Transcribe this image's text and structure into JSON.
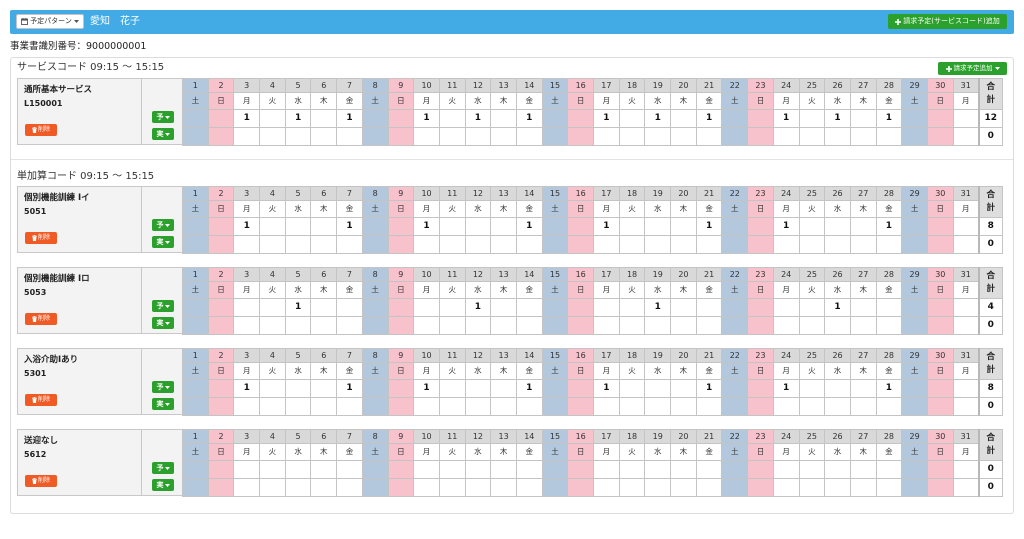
{
  "colors": {
    "header_bar": "#42aae4",
    "button_green": "#2ca02c",
    "button_red": "#f05a24",
    "saturday": "#b3c7dd",
    "sunday": "#f8c2cd",
    "day_header": "#d9d9d9"
  },
  "icons": {
    "pattern": "calendar-icon",
    "add": "plus-icon",
    "menu": "chevron-down-icon",
    "delete": "trash-icon"
  },
  "header": {
    "pattern_button": "予定パターン",
    "user_name": "愛知　花子",
    "add_service_code_button": "請求予定(サービスコード)追加"
  },
  "office_id": "事業書識別番号：9000000001",
  "calendar": {
    "days": [
      "1",
      "2",
      "3",
      "4",
      "5",
      "6",
      "7",
      "8",
      "9",
      "10",
      "11",
      "12",
      "13",
      "14",
      "15",
      "16",
      "17",
      "18",
      "19",
      "20",
      "21",
      "22",
      "23",
      "24",
      "25",
      "26",
      "27",
      "28",
      "29",
      "30",
      "31"
    ],
    "weekdays": [
      "土",
      "日",
      "月",
      "火",
      "水",
      "木",
      "金",
      "土",
      "日",
      "月",
      "火",
      "水",
      "木",
      "金",
      "土",
      "日",
      "月",
      "火",
      "水",
      "木",
      "金",
      "土",
      "日",
      "月",
      "火",
      "水",
      "木",
      "金",
      "土",
      "日",
      "月"
    ],
    "shaded_days": {
      "saturday": [
        1,
        8,
        15,
        22,
        29
      ],
      "sunday": [
        2,
        9,
        16,
        23,
        30
      ]
    },
    "total_header": [
      "合",
      "計"
    ]
  },
  "sections": [
    {
      "title": "サービスコード 09:15 ～ 15:15",
      "add_button": "請求予定追加",
      "services": [
        {
          "name": "通所基本サービス",
          "code": "L150001",
          "delete_button": "削除",
          "plan_button": "予",
          "actual_button": "実",
          "plan": {
            "3": "1",
            "5": "1",
            "7": "1",
            "10": "1",
            "12": "1",
            "14": "1",
            "17": "1",
            "19": "1",
            "21": "1",
            "24": "1",
            "26": "1",
            "28": "1"
          },
          "actual": {},
          "plan_total": "12",
          "actual_total": "0"
        }
      ]
    },
    {
      "title": "単加算コード 09:15 ～ 15:15",
      "services": [
        {
          "name": "個別機能訓練 Ⅰイ",
          "code": "5051",
          "delete_button": "削除",
          "plan_button": "予",
          "actual_button": "実",
          "plan": {
            "3": "1",
            "7": "1",
            "10": "1",
            "14": "1",
            "17": "1",
            "21": "1",
            "24": "1",
            "28": "1"
          },
          "actual": {},
          "plan_total": "8",
          "actual_total": "0"
        },
        {
          "name": "個別機能訓練 Ⅰロ",
          "code": "5053",
          "delete_button": "削除",
          "plan_button": "予",
          "actual_button": "実",
          "plan": {
            "5": "1",
            "12": "1",
            "19": "1",
            "26": "1"
          },
          "actual": {},
          "plan_total": "4",
          "actual_total": "0"
        },
        {
          "name": "入浴介助Ⅰあり",
          "code": "5301",
          "delete_button": "削除",
          "plan_button": "予",
          "actual_button": "実",
          "plan": {
            "3": "1",
            "7": "1",
            "10": "1",
            "14": "1",
            "17": "1",
            "21": "1",
            "24": "1",
            "28": "1"
          },
          "actual": {},
          "plan_total": "8",
          "actual_total": "0"
        },
        {
          "name": "送迎なし",
          "code": "5612",
          "delete_button": "削除",
          "plan_button": "予",
          "actual_button": "実",
          "plan": {},
          "actual": {},
          "plan_total": "0",
          "actual_total": "0"
        }
      ]
    }
  ]
}
